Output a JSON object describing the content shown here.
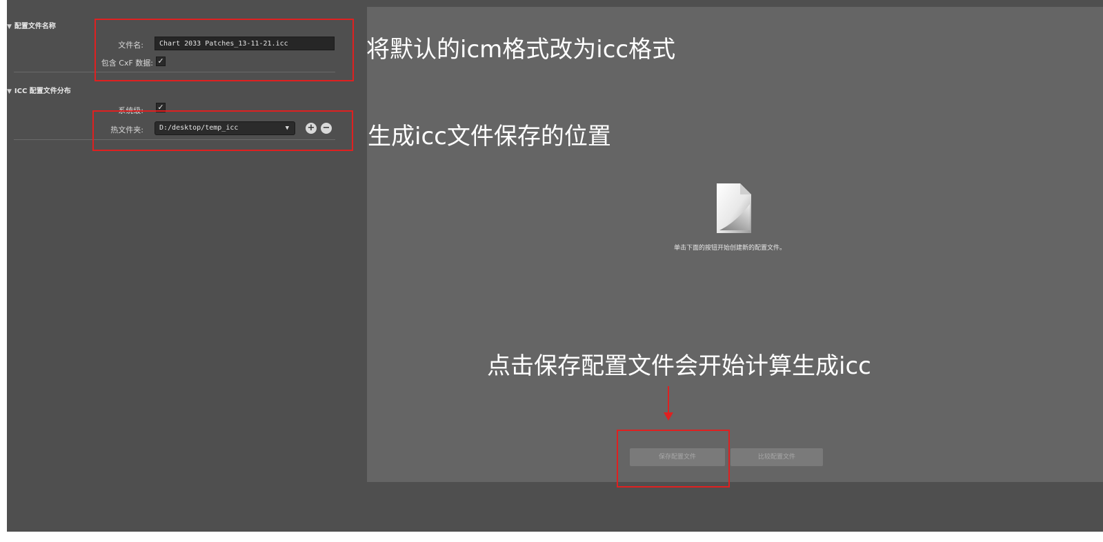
{
  "profile_name_section": {
    "header": "配置文件名称",
    "filename_label": "文件名:",
    "filename_value": "Chart 2033 Patches_13-11-21.icc",
    "cxf_label": "包含 CxF 数据:",
    "cxf_checked": true
  },
  "icc_distribution_section": {
    "header": "ICC 配置文件分布",
    "system_label": "系统级:",
    "system_checked": true,
    "hot_folder_label": "热文件夹:",
    "hot_folder_value": "D:/desktop/temp_icc"
  },
  "main": {
    "placeholder_message": "单击下面的按钮开始创建新的配置文件。",
    "save_button_label": "保存配置文件",
    "compare_button_label": "比较配置文件"
  },
  "annotations": {
    "format_note": "将默认的icm格式改为icc格式",
    "location_note": "生成icc文件保存的位置",
    "save_note": "点击保存配置文件会开始计算生成icc",
    "color": "#e02020"
  }
}
